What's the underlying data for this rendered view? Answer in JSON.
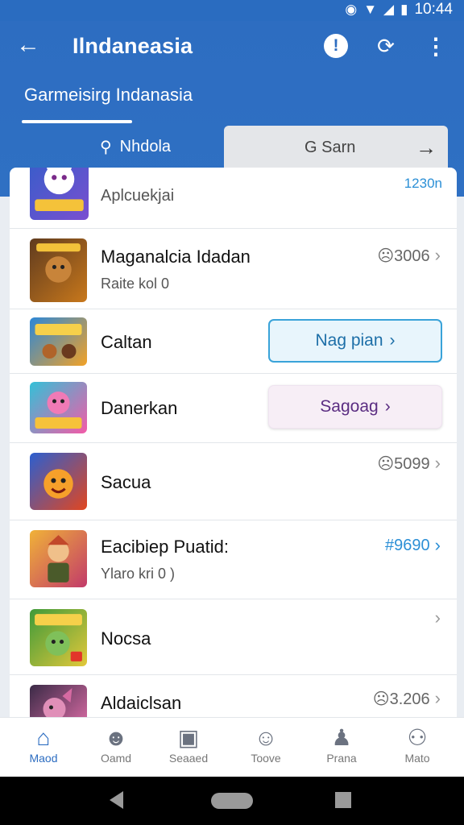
{
  "status": {
    "time": "10:44"
  },
  "appbar": {
    "title": "Ilndaneasia",
    "subtab": "Garmeisirg Indanasia"
  },
  "search": {
    "left_label": "Nhdola",
    "right_label": "G Sarn"
  },
  "list": {
    "top_tag": "1230n",
    "rows": [
      {
        "name": "Aplcuekjai",
        "sub": "",
        "price": "",
        "button": ""
      },
      {
        "name": "Maganalcia Idadan",
        "sub": "Raite kol 0",
        "price": "☹3006",
        "button": ""
      },
      {
        "name": "Caltan",
        "sub": "",
        "price": "",
        "button": "Nag pian"
      },
      {
        "name": "Danerkan",
        "sub": "",
        "price": "",
        "button": "Sagoag"
      },
      {
        "name": "Sacua",
        "sub": "",
        "price": "☹5099",
        "button": ""
      },
      {
        "name": "Eacibiep Puatid:",
        "sub": "Ylaro kri 0  )",
        "price": "#9690",
        "button": ""
      },
      {
        "name": "Nocsa",
        "sub": "",
        "price": "",
        "button": ""
      },
      {
        "name": "Aldaiclsan",
        "sub": "",
        "price": "☹3.206",
        "button": ""
      }
    ]
  },
  "bottomnav": {
    "items": [
      {
        "label": "Maod",
        "icon": "home-icon"
      },
      {
        "label": "Oamd",
        "icon": "game-icon"
      },
      {
        "label": "Seaaed",
        "icon": "store-icon"
      },
      {
        "label": "Toove",
        "icon": "smile-icon"
      },
      {
        "label": "Prana",
        "icon": "person-icon"
      },
      {
        "label": "Mato",
        "icon": "profile-icon"
      }
    ]
  },
  "colors": {
    "primary": "#2d6dc1",
    "accent": "#2b8fd6",
    "pill_blue_bg": "#e8f5fc",
    "pill_pink_bg": "#f7eef6"
  }
}
